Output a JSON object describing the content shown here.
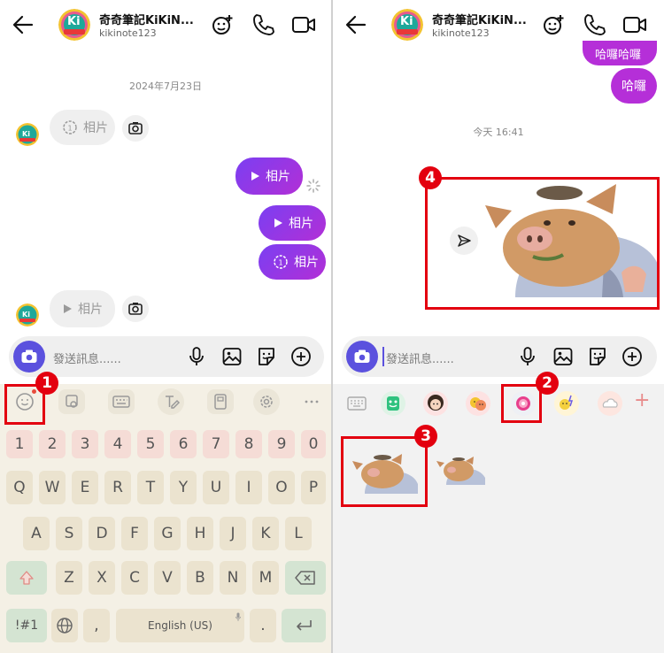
{
  "header": {
    "name": "奇奇筆記KiKiN...",
    "username": "kikinote123",
    "avatar_text": "Ki"
  },
  "left_panel": {
    "date_separator": "2024年7月23日",
    "messages": [
      {
        "side": "in",
        "label": "相片",
        "kind": "timed"
      },
      {
        "side": "out",
        "label": "相片",
        "kind": "play"
      },
      {
        "side": "out",
        "label": "相片",
        "kind": "play"
      },
      {
        "side": "out",
        "label": "相片",
        "kind": "timed"
      },
      {
        "side": "in",
        "label": "相片",
        "kind": "play"
      }
    ],
    "composer_placeholder": "發送訊息......",
    "keyboard": {
      "number_row": [
        "1",
        "2",
        "3",
        "4",
        "5",
        "6",
        "7",
        "8",
        "9",
        "0"
      ],
      "row1": [
        "Q",
        "W",
        "E",
        "R",
        "T",
        "Y",
        "U",
        "I",
        "O",
        "P"
      ],
      "row2": [
        "A",
        "S",
        "D",
        "F",
        "G",
        "H",
        "J",
        "K",
        "L"
      ],
      "row3": [
        "Z",
        "X",
        "C",
        "V",
        "B",
        "N",
        "M"
      ],
      "symbols_key": "!#1",
      "comma_key": ",",
      "space_key": "English (US)",
      "period_key": "."
    }
  },
  "right_panel": {
    "top_bubbles": [
      "哈囉哈囉",
      "哈囉"
    ],
    "time_separator": "今天 16:41",
    "composer_placeholder": "發送訊息......",
    "add_tab_label": "+"
  },
  "annotations": {
    "step1": "1",
    "step2": "2",
    "step3": "3",
    "step4": "4",
    "box_color": "#e3000f"
  },
  "colors": {
    "accent_purple": "#7b3ff2",
    "bubble_magenta": "#b52fd8",
    "camera_button": "#5b51de"
  }
}
